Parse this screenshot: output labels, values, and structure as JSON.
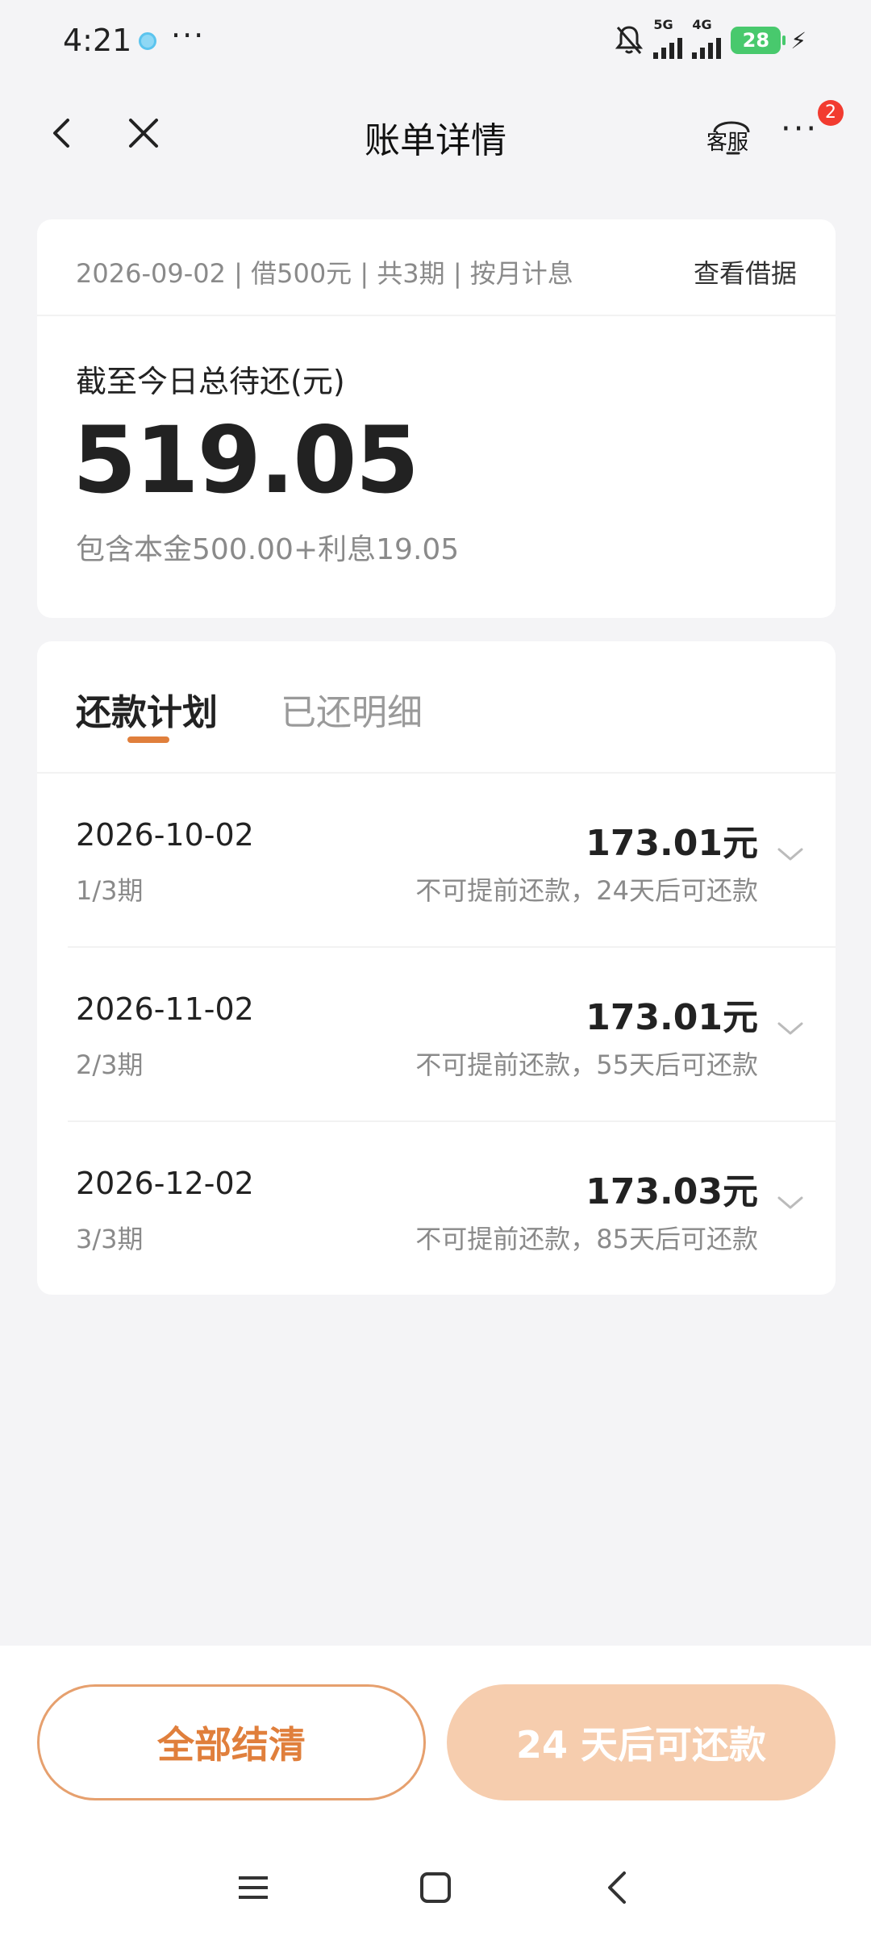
{
  "status_bar": {
    "time": "4:21",
    "more": "···",
    "signal_1_label": "5G",
    "signal_2_label": "4G",
    "battery": "28"
  },
  "nav": {
    "title": "账单详情",
    "service_label": "客服",
    "more_label": "···",
    "badge_count": "2"
  },
  "summary": {
    "loan_info": "2026-09-02 | 借500元 | 共3期 | 按月计息",
    "view_contract": "查看借据",
    "total_label": "截至今日总待还(元)",
    "total_amount": "519.05",
    "breakdown": "包含本金500.00+利息19.05"
  },
  "plan": {
    "tab_plan": "还款计划",
    "tab_paid": "已还明细",
    "rows": [
      {
        "date": "2026-10-02",
        "period": "1/3期",
        "amount": "173.01元",
        "note": "不可提前还款，24天后可还款"
      },
      {
        "date": "2026-11-02",
        "period": "2/3期",
        "amount": "173.01元",
        "note": "不可提前还款，55天后可还款"
      },
      {
        "date": "2026-12-02",
        "period": "3/3期",
        "amount": "173.03元",
        "note": "不可提前还款，85天后可还款"
      }
    ]
  },
  "actions": {
    "settle_all": "全部结清",
    "repay_in_days": "24 天后可还款"
  },
  "colors": {
    "accent": "#e07f3c",
    "accent_light": "#f6cdae",
    "badge": "#f23b30",
    "battery": "#48c96d"
  },
  "icons": [
    "back-icon",
    "close-icon",
    "headset-icon",
    "more-icon",
    "chevron-down-icon",
    "menu-icon",
    "home-icon",
    "bell-off-icon",
    "signal-icon",
    "battery-icon"
  ]
}
